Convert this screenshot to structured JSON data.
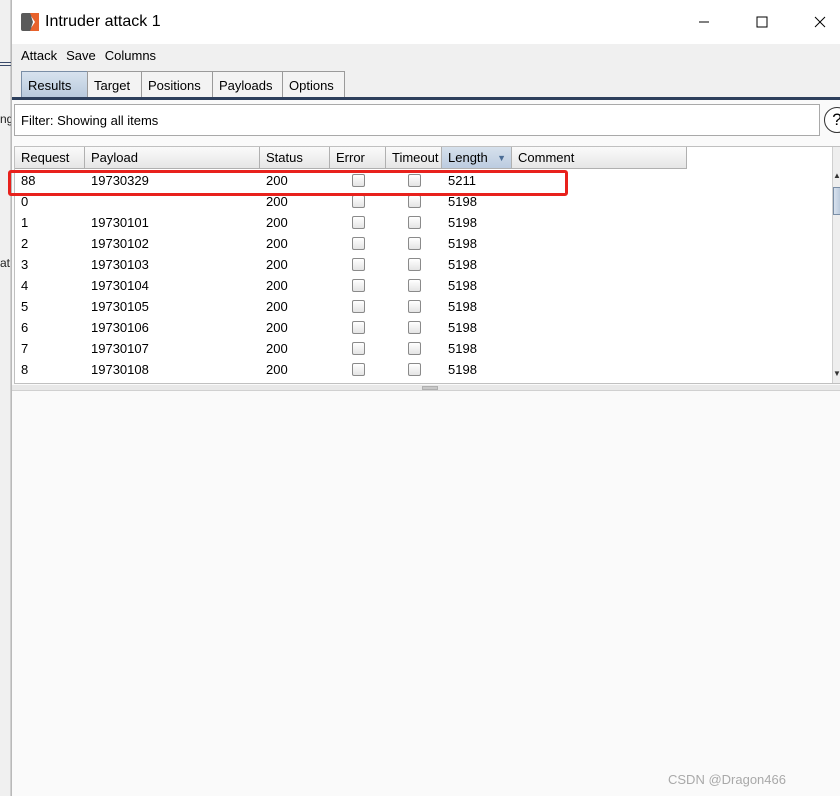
{
  "window": {
    "title": "Intruder attack 1"
  },
  "menu": [
    "Attack",
    "Save",
    "Columns"
  ],
  "tabs": [
    {
      "label": "Results",
      "active": true
    },
    {
      "label": "Target",
      "active": false
    },
    {
      "label": "Positions",
      "active": false
    },
    {
      "label": "Payloads",
      "active": false
    },
    {
      "label": "Options",
      "active": false
    }
  ],
  "filter": {
    "text": "Filter: Showing all items"
  },
  "table": {
    "columns": [
      "Request",
      "Payload",
      "Status",
      "Error",
      "Timeout",
      "Length",
      "Comment"
    ],
    "sorted_column": "Length",
    "rows": [
      {
        "request": "88",
        "payload": "19730329",
        "status": "200",
        "error": false,
        "timeout": false,
        "length": "5211",
        "comment": "",
        "highlighted": true
      },
      {
        "request": "0",
        "payload": "",
        "status": "200",
        "error": false,
        "timeout": false,
        "length": "5198",
        "comment": ""
      },
      {
        "request": "1",
        "payload": "19730101",
        "status": "200",
        "error": false,
        "timeout": false,
        "length": "5198",
        "comment": ""
      },
      {
        "request": "2",
        "payload": "19730102",
        "status": "200",
        "error": false,
        "timeout": false,
        "length": "5198",
        "comment": ""
      },
      {
        "request": "3",
        "payload": "19730103",
        "status": "200",
        "error": false,
        "timeout": false,
        "length": "5198",
        "comment": ""
      },
      {
        "request": "4",
        "payload": "19730104",
        "status": "200",
        "error": false,
        "timeout": false,
        "length": "5198",
        "comment": ""
      },
      {
        "request": "5",
        "payload": "19730105",
        "status": "200",
        "error": false,
        "timeout": false,
        "length": "5198",
        "comment": ""
      },
      {
        "request": "6",
        "payload": "19730106",
        "status": "200",
        "error": false,
        "timeout": false,
        "length": "5198",
        "comment": ""
      },
      {
        "request": "7",
        "payload": "19730107",
        "status": "200",
        "error": false,
        "timeout": false,
        "length": "5198",
        "comment": ""
      },
      {
        "request": "8",
        "payload": "19730108",
        "status": "200",
        "error": false,
        "timeout": false,
        "length": "5198",
        "comment": ""
      }
    ]
  },
  "background_fragments": [
    "ng",
    "at"
  ],
  "colors": {
    "highlight": "#e8211c",
    "tab_underline": "#2d3f5c",
    "icon_orange": "#e8622c"
  },
  "watermark": "CSDN @Dragon466"
}
